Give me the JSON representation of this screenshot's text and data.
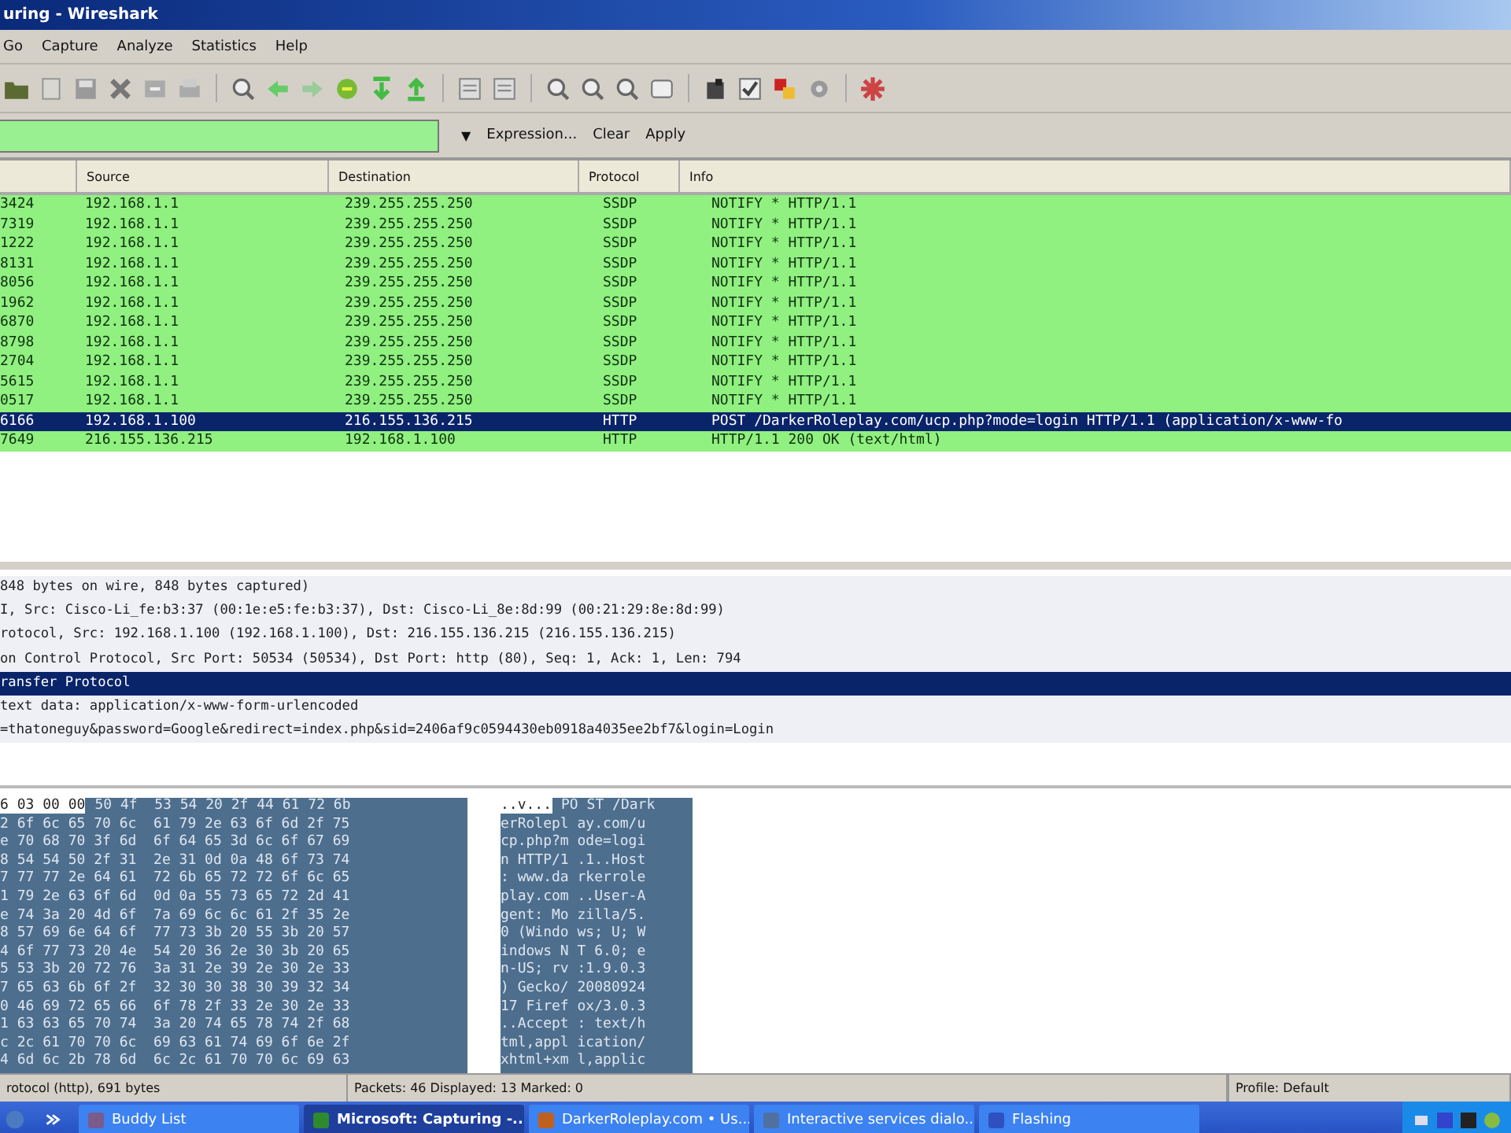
{
  "window": {
    "title": "uring - Wireshark"
  },
  "menu": [
    "Go",
    "Capture",
    "Analyze",
    "Statistics",
    "Help"
  ],
  "filter": {
    "dropdown": "▼",
    "buttons": [
      "Expression...",
      "Clear",
      "Apply"
    ]
  },
  "packet_list": {
    "columns": [
      "",
      "Source",
      "Destination",
      "Protocol",
      "Info"
    ],
    "rows": [
      {
        "column_1": "3424",
        "source": "192.168.1.1",
        "destination": "239.255.255.250",
        "protocol": "SSDP",
        "info": "NOTIFY * HTTP/1.1",
        "selected": false
      },
      {
        "column_1": "7319",
        "source": "192.168.1.1",
        "destination": "239.255.255.250",
        "protocol": "SSDP",
        "info": "NOTIFY * HTTP/1.1",
        "selected": false
      },
      {
        "column_1": "1222",
        "source": "192.168.1.1",
        "destination": "239.255.255.250",
        "protocol": "SSDP",
        "info": "NOTIFY * HTTP/1.1",
        "selected": false
      },
      {
        "column_1": "8131",
        "source": "192.168.1.1",
        "destination": "239.255.255.250",
        "protocol": "SSDP",
        "info": "NOTIFY * HTTP/1.1",
        "selected": false
      },
      {
        "column_1": "8056",
        "source": "192.168.1.1",
        "destination": "239.255.255.250",
        "protocol": "SSDP",
        "info": "NOTIFY * HTTP/1.1",
        "selected": false
      },
      {
        "column_1": "1962",
        "source": "192.168.1.1",
        "destination": "239.255.255.250",
        "protocol": "SSDP",
        "info": "NOTIFY * HTTP/1.1",
        "selected": false
      },
      {
        "column_1": "6870",
        "source": "192.168.1.1",
        "destination": "239.255.255.250",
        "protocol": "SSDP",
        "info": "NOTIFY * HTTP/1.1",
        "selected": false
      },
      {
        "column_1": "8798",
        "source": "192.168.1.1",
        "destination": "239.255.255.250",
        "protocol": "SSDP",
        "info": "NOTIFY * HTTP/1.1",
        "selected": false
      },
      {
        "column_1": "2704",
        "source": "192.168.1.1",
        "destination": "239.255.255.250",
        "protocol": "SSDP",
        "info": "NOTIFY * HTTP/1.1",
        "selected": false
      },
      {
        "column_1": "5615",
        "source": "192.168.1.1",
        "destination": "239.255.255.250",
        "protocol": "SSDP",
        "info": "NOTIFY * HTTP/1.1",
        "selected": false
      },
      {
        "column_1": "0517",
        "source": "192.168.1.1",
        "destination": "239.255.255.250",
        "protocol": "SSDP",
        "info": "NOTIFY * HTTP/1.1",
        "selected": false
      },
      {
        "column_1": "6166",
        "source": "192.168.1.100",
        "destination": "216.155.136.215",
        "protocol": "HTTP",
        "info": "POST /DarkerRoleplay.com/ucp.php?mode=login HTTP/1.1  (application/x-www-fo",
        "selected": true
      },
      {
        "column_1": "7649",
        "source": "216.155.136.215",
        "destination": "192.168.1.100",
        "protocol": "HTTP",
        "info": "HTTP/1.1 200 OK  (text/html)",
        "selected": false
      }
    ]
  },
  "details": [
    {
      "text": "848 bytes on wire, 848 bytes captured)",
      "selected": false
    },
    {
      "text": "I, Src: Cisco-Li_fe:b3:37 (00:1e:e5:fe:b3:37), Dst: Cisco-Li_8e:8d:99 (00:21:29:8e:8d:99)",
      "selected": false
    },
    {
      "text": "rotocol, Src: 192.168.1.100 (192.168.1.100), Dst: 216.155.136.215 (216.155.136.215)",
      "selected": false
    },
    {
      "text": "on Control Protocol, Src Port: 50534 (50534), Dst Port: http (80), Seq: 1, Ack: 1, Len: 794",
      "selected": false
    },
    {
      "text": "ransfer Protocol",
      "selected": true
    },
    {
      "text": " text data: application/x-www-form-urlencoded",
      "selected": false
    },
    {
      "text": "=thatoneguy&password=Google&redirect=index.php&sid=2406af9c0594430eb0918a4035ee2bf7&login=Login",
      "selected": false
    }
  ],
  "bytes": [
    {
      "hex_plain": "6 03 00 00",
      "hex": "50 4f  53 54 20 2f 44 61 72 6b",
      "ascii_plain": "..v...",
      "ascii": "PO ST /Dark"
    },
    {
      "hex": "2 6f 6c 65 70 6c  61 79 2e 63 6f 6d 2f 75",
      "ascii": "erRolepl ay.com/u"
    },
    {
      "hex": "e 70 68 70 3f 6d  6f 64 65 3d 6c 6f 67 69",
      "ascii": "cp.php?m ode=logi"
    },
    {
      "hex": "8 54 54 50 2f 31  2e 31 0d 0a 48 6f 73 74",
      "ascii": "n HTTP/1 .1..Host"
    },
    {
      "hex": "7 77 77 2e 64 61  72 6b 65 72 72 6f 6c 65",
      "ascii": ": www.da rkerrole"
    },
    {
      "hex": "1 79 2e 63 6f 6d  0d 0a 55 73 65 72 2d 41",
      "ascii": "play.com ..User-A"
    },
    {
      "hex": "e 74 3a 20 4d 6f  7a 69 6c 6c 61 2f 35 2e",
      "ascii": "gent: Mo zilla/5."
    },
    {
      "hex": "8 57 69 6e 64 6f  77 73 3b 20 55 3b 20 57",
      "ascii": "0 (Windo ws; U; W"
    },
    {
      "hex": "4 6f 77 73 20 4e  54 20 36 2e 30 3b 20 65",
      "ascii": "indows N T 6.0; e"
    },
    {
      "hex": "5 53 3b 20 72 76  3a 31 2e 39 2e 30 2e 33",
      "ascii": "n-US; rv :1.9.0.3"
    },
    {
      "hex": "7 65 63 6b 6f 2f  32 30 30 38 30 39 32 34",
      "ascii": ") Gecko/ 20080924"
    },
    {
      "hex": "0 46 69 72 65 66  6f 78 2f 33 2e 30 2e 33",
      "ascii": "17 Firef ox/3.0.3"
    },
    {
      "hex": "1 63 63 65 70 74  3a 20 74 65 78 74 2f 68",
      "ascii": "..Accept : text/h"
    },
    {
      "hex": "c 2c 61 70 70 6c  69 63 61 74 69 6f 6e 2f",
      "ascii": "tml,appl ication/"
    },
    {
      "hex": "4 6d 6c 2b 78 6d  6c 2c 61 70 70 6c 69 63",
      "ascii": "xhtml+xm l,applic"
    }
  ],
  "status_bar": {
    "field": "rotocol (http), 691 bytes",
    "packets": "Packets: 46 Displayed: 13 Marked: 0",
    "profile": "Profile: Default"
  },
  "taskbar": [
    {
      "label": "Buddy List",
      "selected": false
    },
    {
      "label": "Microsoft: Capturing -...",
      "selected": true
    },
    {
      "label": "DarkerRoleplay.com • Us...",
      "selected": false
    },
    {
      "label": "Interactive services dialo...",
      "selected": false
    },
    {
      "label": "Flashing",
      "selected": false
    }
  ]
}
